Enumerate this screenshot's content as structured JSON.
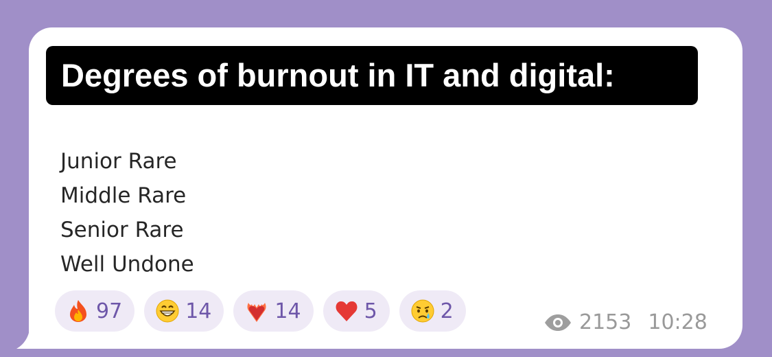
{
  "message": {
    "title": "Degrees of burnout in IT and digital:",
    "lines": [
      "Junior Rare",
      "Middle Rare",
      "Senior Rare",
      "Well Undone"
    ],
    "reactions": [
      {
        "icon": "fire-icon",
        "count": "97"
      },
      {
        "icon": "grin-icon",
        "count": "14"
      },
      {
        "icon": "heart-on-fire-icon",
        "count": "14"
      },
      {
        "icon": "red-heart-icon",
        "count": "5"
      },
      {
        "icon": "crying-face-icon",
        "count": "2"
      }
    ],
    "views": "2153",
    "time": "10:28"
  },
  "colors": {
    "background": "#a08fc8",
    "bubble": "#ffffff",
    "reaction_chip": "#efeaf6",
    "reaction_count": "#6e57a9",
    "meta_text": "#999999"
  }
}
